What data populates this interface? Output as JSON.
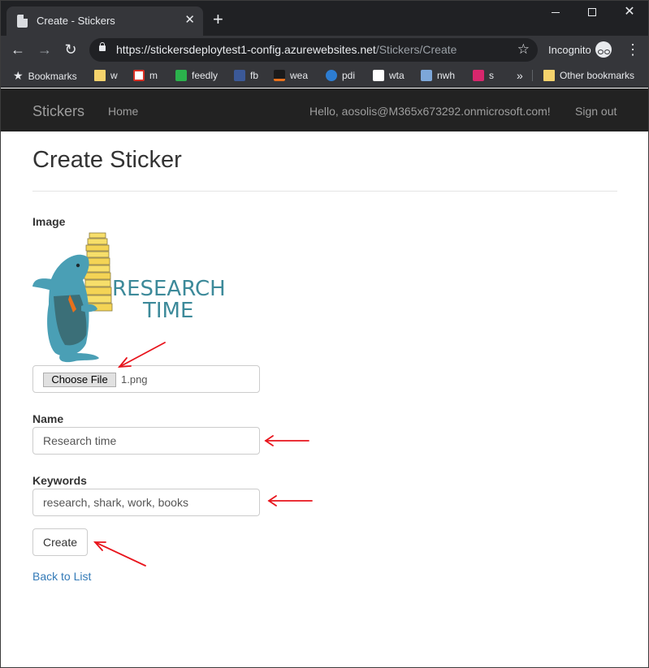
{
  "browser": {
    "tab_title": "Create - Stickers",
    "tab_close": "✕",
    "new_tab": "+",
    "url_host": "https://stickersdeploytest1-config.azurewebsites.net",
    "url_path": "/Stickers/Create",
    "incognito_label": "Incognito",
    "bookmarks": [
      {
        "label": "Bookmarks",
        "icon": "star-icon"
      },
      {
        "label": "w",
        "icon": "folder-icon"
      },
      {
        "label": "m",
        "icon": "gmail-icon"
      },
      {
        "label": "feedly",
        "icon": "feedly-icon"
      },
      {
        "label": "fb",
        "icon": "facebook-icon"
      },
      {
        "label": "wea",
        "icon": "weather-icon"
      },
      {
        "label": "pdi",
        "icon": "pdi-icon"
      },
      {
        "label": "wta",
        "icon": "wta-icon"
      },
      {
        "label": "nwh",
        "icon": "nwh-icon"
      },
      {
        "label": "s",
        "icon": "s-icon"
      }
    ],
    "overflow": "»",
    "other_bookmarks": "Other bookmarks"
  },
  "site_nav": {
    "brand": "Stickers",
    "home": "Home",
    "hello": "Hello, aosolis@M365x673292.onmicrosoft.com!",
    "sign_out": "Sign out"
  },
  "form": {
    "title": "Create Sticker",
    "image_label": "Image",
    "sticker_text_line1": "RESEARCH",
    "sticker_text_line2": "TIME",
    "choose_file_label": "Choose File",
    "file_name": "1.png",
    "name_label": "Name",
    "name_value": "Research time",
    "keywords_label": "Keywords",
    "keywords_value": "research, shark, work, books",
    "create_label": "Create",
    "back_link": "Back to List"
  },
  "colors": {
    "annotation_arrow": "#e8141c",
    "sticker_text": "#3d8a9a",
    "shark": "#4a9fb5",
    "books": "#f7df6a",
    "link": "#337ab7"
  }
}
